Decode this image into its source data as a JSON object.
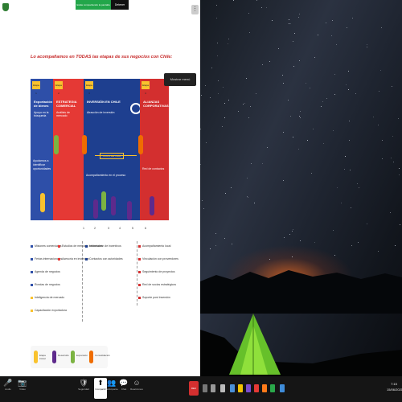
{
  "meeting_toolbar": {
    "share_status": "Estás compartiendo la pantalla",
    "stop_label": "Detener",
    "view_icon": "view-options-icon"
  },
  "document": {
    "title": "Lo acompañamos en TODAS las etapas de sus negocios con Chile:",
    "stages": [
      {
        "tag": "Etapa 1",
        "title": "Exportación de bienes",
        "subtitle": "Apoyo en la búsqueda",
        "desc": "Ayudamos a identificar oportunidades"
      },
      {
        "tag": "Etapa 2",
        "title": "ESTRATEGIA COMERCIAL",
        "subtitle": "Análisis de mercado",
        "desc": ""
      },
      {
        "tag": "Etapa 3",
        "title": "INVERSIÓN EN CHILE",
        "subtitle": "Atracción de inversión",
        "desc": "Acompañamiento en el proceso",
        "cycle": "CICLO DE VIDA"
      },
      {
        "tag": "Etapa 4",
        "title": "ALIANZAS CORPORATIVAS",
        "subtitle": "",
        "desc": "Red de contactos"
      }
    ],
    "ages": [
      "1",
      "2",
      "3",
      "4",
      "5",
      "6"
    ],
    "columns": [
      {
        "items": [
          "Misiones comerciales",
          "Ferias internacionales",
          "Agenda de negocios",
          "Rondas de negocios",
          "Inteligencia de mercado",
          "Capacitación exportadora"
        ]
      },
      {
        "items": [
          "Estudios de mercado sectoriales",
          "Asesoría en inversión",
          "Información de incentivos",
          "Contactos con autoridades"
        ]
      },
      {
        "items": [
          "Acompañamiento local",
          "Vinculación con proveedores",
          "Seguimiento de proyectos",
          "Red de socios estratégicos",
          "Soporte post inversión"
        ]
      }
    ],
    "legend": [
      "Etapa inicial",
      "Desarrollo",
      "Expansión",
      "Consolidación"
    ]
  },
  "desktop": {
    "float_menu": "Mostrar menú"
  },
  "taskbar": {
    "buttons": [
      {
        "glyph": "🎤",
        "label": "Audio"
      },
      {
        "glyph": "📷",
        "label": "Vídeo"
      },
      {
        "glyph": "🛡",
        "label": "Seguridad"
      },
      {
        "glyph": "👥",
        "label": "Participantes"
      },
      {
        "glyph": "💬",
        "label": "Chat"
      },
      {
        "glyph": "⬆",
        "label": "Compartir"
      },
      {
        "glyph": "⏺",
        "label": "Grabar"
      },
      {
        "glyph": "☺",
        "label": "Reacciones"
      }
    ],
    "rec_label": "REC",
    "time": "7:15",
    "date": "15/06/2021"
  },
  "colors": {
    "blue": "#2e4fa8",
    "dark_blue": "#1e3f8f",
    "red": "#e53935",
    "yellow": "#f9c22e",
    "purple": "#5e2a8c",
    "green": "#7cb342",
    "orange": "#ef6c00",
    "share_green": "#22a64a"
  }
}
